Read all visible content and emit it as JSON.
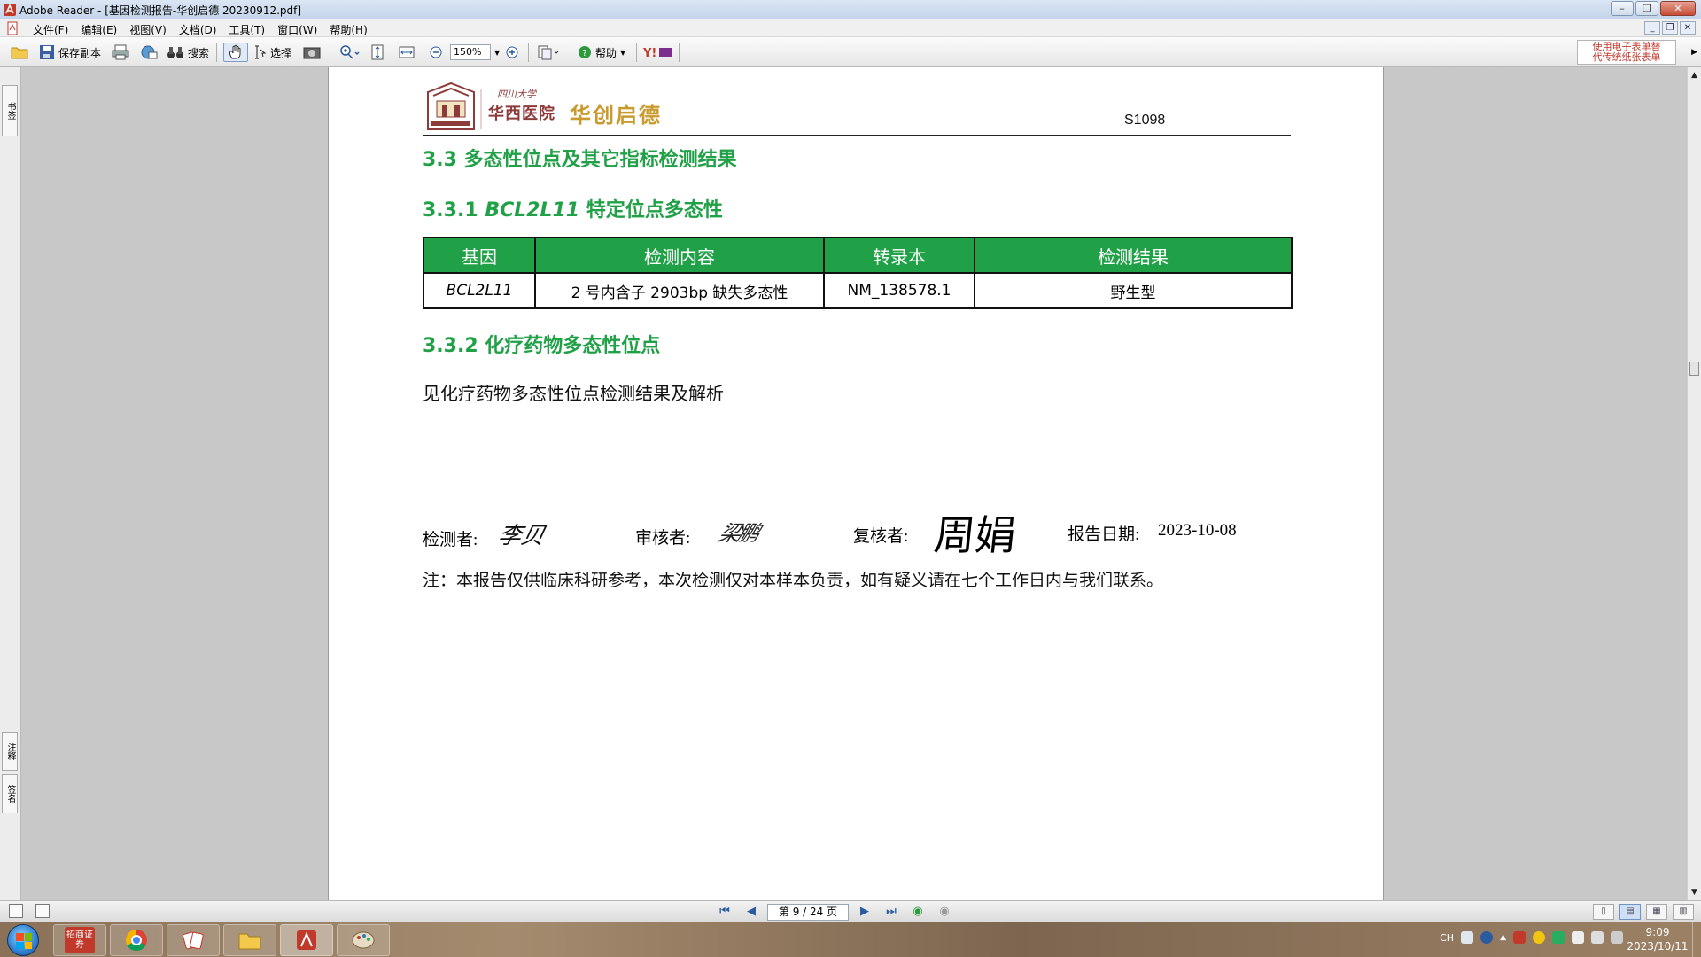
{
  "window": {
    "title": "Adobe Reader - [基因检测报告-华创启德 20230912.pdf]"
  },
  "menu": {
    "items": [
      "文件(F)",
      "编辑(E)",
      "视图(V)",
      "文档(D)",
      "工具(T)",
      "窗口(W)",
      "帮助(H)"
    ]
  },
  "toolbar": {
    "save_copy": "保存副本",
    "search": "搜索",
    "select": "选择",
    "zoom_value": "150%",
    "help": "帮助",
    "ad_line1": "使用电子表单替",
    "ad_line2": "代传统纸张表单"
  },
  "nav": {
    "tab_top": "书签",
    "tab_mid": "注释",
    "tab_bot": "签名"
  },
  "document": {
    "logo_text_1": "四川大学",
    "logo_text_2": "华西医院",
    "logo_brand": "华创启德",
    "report_id": "S1098",
    "section_title": "3.3 多态性位点及其它指标检测结果",
    "sub1_prefix": "3.3.1",
    "sub1_gene": "BCL2L11",
    "sub1_suffix": "特定位点多态性",
    "table": {
      "headers": [
        "基因",
        "检测内容",
        "转录本",
        "检测结果"
      ],
      "rows": [
        [
          "BCL2L11",
          "2 号内含子 2903bp 缺失多态性",
          "NM_138578.1",
          "野生型"
        ]
      ]
    },
    "sub2": "3.3.2 化疗药物多态性位点",
    "body": "见化疗药物多态性位点检测结果及解析",
    "signatures": {
      "tester_label": "检测者:",
      "tester_sig": "李贝",
      "reviewer_label": "审核者:",
      "reviewer_sig": "梁鹏",
      "rechecker_label": "复核者:",
      "rechecker_sig": "周娟",
      "date_label": "报告日期:",
      "date_value": "2023-10-08"
    },
    "note": "注：本报告仅供临床科研参考，本次检测仅对本样本负责，如有疑义请在七个工作日内与我们联系。"
  },
  "status": {
    "page_indicator": "第 9 / 24 页"
  },
  "taskbar": {
    "ime": "CH",
    "time": "9:09",
    "date": "2023/10/11",
    "app1_label": "招商证券"
  },
  "colors": {
    "accent_green": "#21a147",
    "header_text": "#ffffff"
  }
}
